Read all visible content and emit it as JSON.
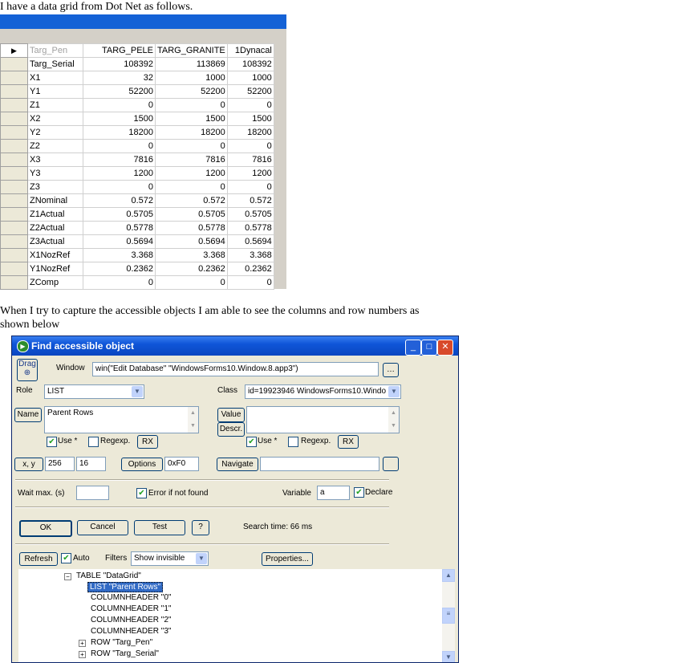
{
  "intro_text": "I have a data grid from Dot Net as follows.",
  "grid": {
    "row_indicator": "▶",
    "header": [
      "Targ_Pen",
      "TARG_PELE",
      "TARG_GRANITE",
      "1Dynacal"
    ],
    "rows": [
      [
        "Targ_Serial",
        "108392",
        "113869",
        "108392"
      ],
      [
        "X1",
        "32",
        "1000",
        "1000"
      ],
      [
        "Y1",
        "52200",
        "52200",
        "52200"
      ],
      [
        "Z1",
        "0",
        "0",
        "0"
      ],
      [
        "X2",
        "1500",
        "1500",
        "1500"
      ],
      [
        "Y2",
        "18200",
        "18200",
        "18200"
      ],
      [
        "Z2",
        "0",
        "0",
        "0"
      ],
      [
        "X3",
        "7816",
        "7816",
        "7816"
      ],
      [
        "Y3",
        "1200",
        "1200",
        "1200"
      ],
      [
        "Z3",
        "0",
        "0",
        "0"
      ],
      [
        "ZNominal",
        "0.572",
        "0.572",
        "0.572"
      ],
      [
        "Z1Actual",
        "0.5705",
        "0.5705",
        "0.5705"
      ],
      [
        "Z2Actual",
        "0.5778",
        "0.5778",
        "0.5778"
      ],
      [
        "Z3Actual",
        "0.5694",
        "0.5694",
        "0.5694"
      ],
      [
        "X1NozRef",
        "3.368",
        "3.368",
        "3.368"
      ],
      [
        "Y1NozRef",
        "0.2362",
        "0.2362",
        "0.2362"
      ],
      [
        "ZComp",
        "0",
        "0",
        "0"
      ]
    ]
  },
  "middle_text": "When I try to capture the accessible objects I am able to see the columns and row numbers as shown below",
  "dialog": {
    "title": "Find accessible object",
    "drag_label": "Drag",
    "window_label": "Window",
    "window_value": "win(\"Edit Database\" \"WindowsForms10.Window.8.app3\")",
    "role_label": "Role",
    "role_value": "LIST",
    "class_label": "Class",
    "class_value": "id=19923946 WindowsForms10.Windo",
    "name_button": "Name",
    "name_value": "Parent Rows",
    "value_button": "Value",
    "descr_button": "Descr.",
    "use_label": "Use *",
    "regexp_label": "Regexp.",
    "rx_button": "RX",
    "xy_button": "x, y",
    "x_value": "256",
    "y_value": "16",
    "options_button": "Options",
    "options_value": "0xF0",
    "navigate_button": "Navigate",
    "wait_label": "Wait max. (s)",
    "error_label": "Error if not found",
    "variable_label": "Variable",
    "variable_value": "a",
    "declare_label": "Declare",
    "ok_button": "OK",
    "cancel_button": "Cancel",
    "test_button": "Test",
    "help_button": "?",
    "search_time": "Search time: 66 ms",
    "refresh_button": "Refresh",
    "auto_label": "Auto",
    "filters_label": "Filters",
    "filters_value": "Show invisible",
    "properties_button": "Properties...",
    "tree": [
      "TABLE \"DataGrid\"",
      "LIST \"Parent Rows\"",
      "COLUMNHEADER \"0\"",
      "COLUMNHEADER \"1\"",
      "COLUMNHEADER \"2\"",
      "COLUMNHEADER \"3\"",
      "ROW \"Targ_Pen\"",
      "ROW \"Targ_Serial\""
    ]
  }
}
